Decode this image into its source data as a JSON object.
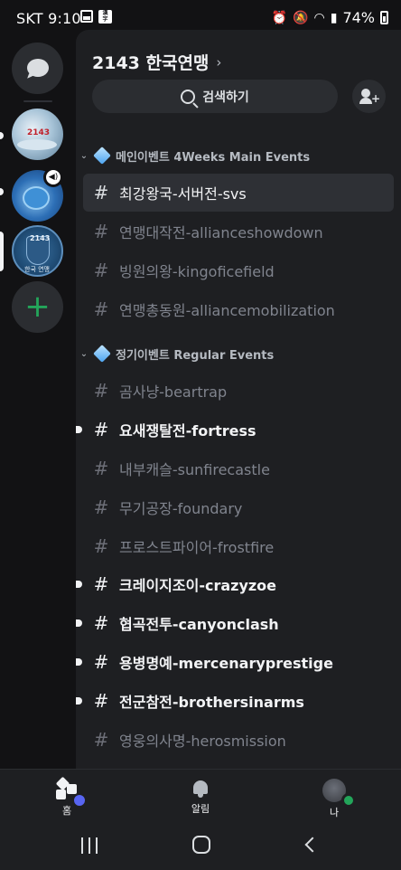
{
  "status_bar": {
    "carrier": "SKT",
    "time": "9:10",
    "battery": "74%",
    "icons": [
      "gallery-icon",
      "chinese-char-icon",
      "alarm-icon",
      "mute-icon",
      "wifi-icon",
      "signal-icon",
      "battery-icon"
    ]
  },
  "server_rail": {
    "dm_icon": "chat-bubble-icon",
    "servers": [
      {
        "label": "2143",
        "selected": false,
        "unread": true
      },
      {
        "label": "",
        "selected": false,
        "unread": true,
        "voice_active": true
      },
      {
        "label": "2143",
        "sub_label": "한국 연맹",
        "selected": true,
        "unread": false
      }
    ],
    "add_icon": "plus-icon"
  },
  "server_header": {
    "title": "2143 한국연맹",
    "chevron": "›",
    "search_label": "검색하기",
    "invite_icon": "add-member-icon"
  },
  "categories": [
    {
      "label": "메인이벤트 4Weeks Main Events",
      "channels": [
        {
          "name": "최강왕국-서버전-svs",
          "active": true,
          "unread": false
        },
        {
          "name": "연맹대작전-allianceshowdown",
          "active": false,
          "unread": false
        },
        {
          "name": "빙원의왕-kingoficefield",
          "active": false,
          "unread": false
        },
        {
          "name": "연맹총동원-alliancemobilization",
          "active": false,
          "unread": false
        }
      ]
    },
    {
      "label": "정기이벤트 Regular Events",
      "channels": [
        {
          "name": "곰사냥-beartrap",
          "active": false,
          "unread": false
        },
        {
          "name": "요새쟁탈전-fortress",
          "active": false,
          "unread": true
        },
        {
          "name": "내부캐슬-sunfirecastle",
          "active": false,
          "unread": false
        },
        {
          "name": "무기공장-foundary",
          "active": false,
          "unread": false
        },
        {
          "name": "프로스트파이어-frostfire",
          "active": false,
          "unread": false
        },
        {
          "name": "크레이지조이-crazyzoe",
          "active": false,
          "unread": true
        },
        {
          "name": "협곡전투-canyonclash",
          "active": false,
          "unread": true
        },
        {
          "name": "용병명예-mercenaryprestige",
          "active": false,
          "unread": true
        },
        {
          "name": "전군참전-brothersinarms",
          "active": false,
          "unread": true
        },
        {
          "name": "영웅의사명-herosmission",
          "active": false,
          "unread": false
        }
      ]
    }
  ],
  "bottom_nav": {
    "home_label": "홈",
    "notifications_label": "알림",
    "me_label": "나"
  },
  "colors": {
    "accent": "#5865f2",
    "online": "#23a55a",
    "add_server": "#23a55a",
    "background": "#1e1f22",
    "rail": "#121214"
  }
}
